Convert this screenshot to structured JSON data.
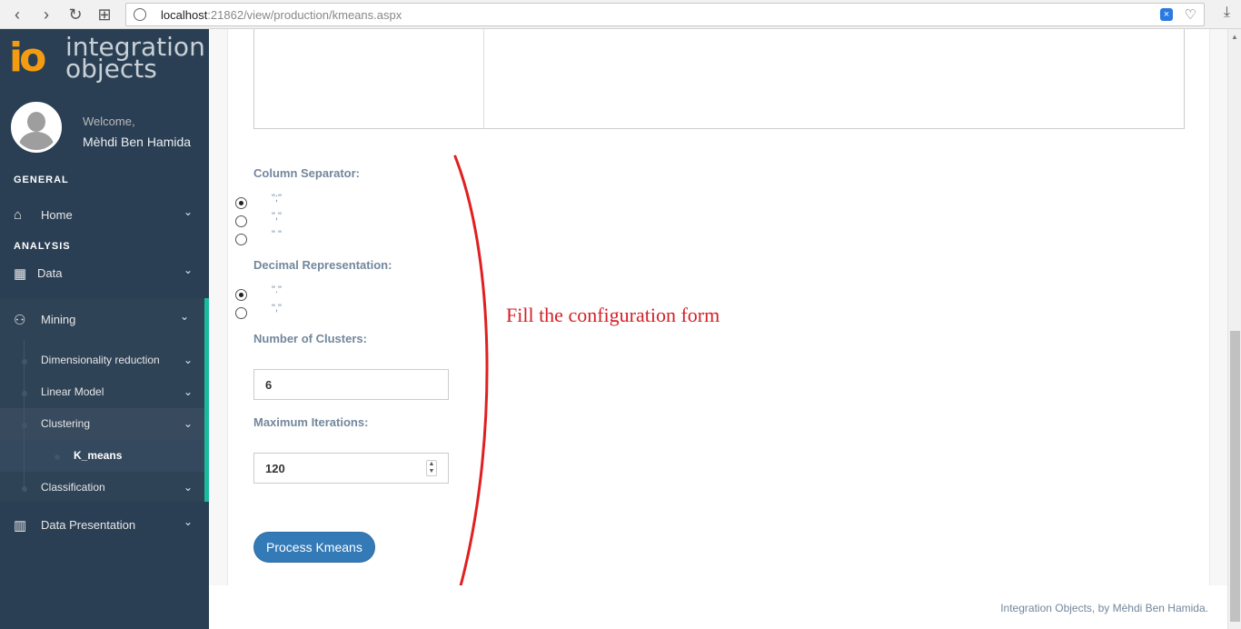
{
  "browser": {
    "back": "‹",
    "forward": "›",
    "reload": "↻",
    "apps": "⊞",
    "url_host": "localhost",
    "url_path": ":21862/view/production/kmeans.aspx",
    "badge_count": "0",
    "badge_x": "×",
    "favorite": "♡",
    "download": "⤓"
  },
  "logo": {
    "mark": "io",
    "text": "integration objects"
  },
  "profile": {
    "welcome": "Welcome,",
    "name": "Mèhdi Ben Hamida"
  },
  "sidebar": {
    "general_title": "GENERAL",
    "analysis_title": "ANALYSIS",
    "home": {
      "label": "Home",
      "icon": "⌂"
    },
    "data": {
      "label": "Data",
      "icon": "▦"
    },
    "mining": {
      "label": "Mining",
      "icon": "⚇"
    },
    "sub_items": {
      "dim": "Dimensionality reduction",
      "linear": "Linear Model",
      "clustering": "Clustering",
      "kmeans": "K_means",
      "classification": "Classification"
    },
    "presentation": {
      "label": "Data Presentation",
      "icon": "▥"
    },
    "chevron": "⌄"
  },
  "form": {
    "column_separator_label": "Column Separator:",
    "column_separators": [
      ";",
      ",",
      " "
    ],
    "column_selected": 0,
    "decimal_label": "Decimal Representation:",
    "decimals": [
      ".",
      ","
    ],
    "decimal_selected": 0,
    "clusters_label": "Number of Clusters:",
    "clusters_value": "6",
    "iterations_label": "Maximum Iterations:",
    "iterations_value": "120",
    "spin_up": "▲",
    "spin_down": "▼",
    "process_button": "Process Kmeans"
  },
  "annotation": {
    "text": "Fill the configuration form",
    "color": "#d42027"
  },
  "footer": {
    "text": "Integration Objects, by Mèhdi Ben Hamida."
  },
  "colors": {
    "sidebar": "#2a3f54",
    "accent": "#1abb9c",
    "button": "#337ab7",
    "label": "#73879c"
  }
}
